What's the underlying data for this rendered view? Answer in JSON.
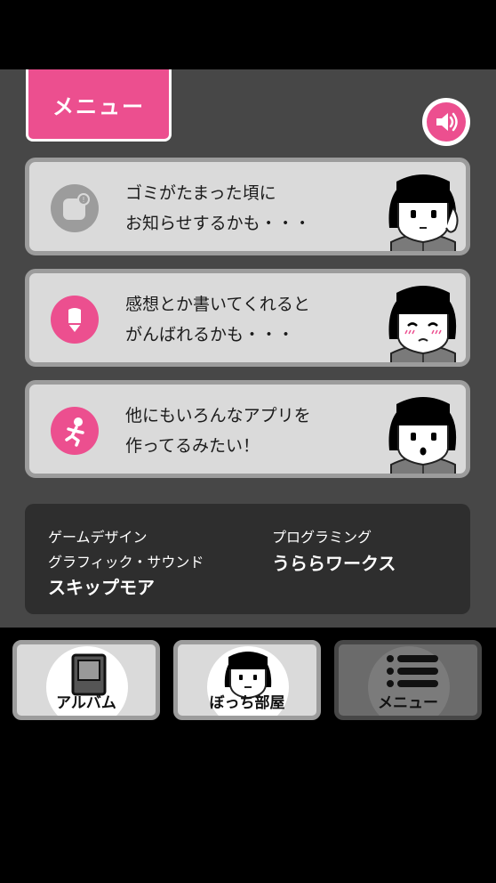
{
  "header": {
    "menu_tab_label": "メニュー",
    "sound_icon": "speaker-icon"
  },
  "cards": [
    {
      "icon": "notification-icon",
      "line1": "ゴミがたまった頃に",
      "line2": "お知らせするかも・・・",
      "face": "neutral"
    },
    {
      "icon": "pencil-icon",
      "line1": "感想とか書いてくれると",
      "line2": "がんばれるかも・・・",
      "face": "blushing"
    },
    {
      "icon": "running-person-icon",
      "line1": "他にもいろんなアプリを",
      "line2": "作ってるみたい！",
      "face": "surprised"
    }
  ],
  "credits": {
    "design_label": "ゲームデザイン",
    "graphics_label": "グラフィック・サウンド",
    "design_name": "スキップモア",
    "programming_label": "プログラミング",
    "programming_name": "うららワークス"
  },
  "nav": {
    "album_label": "アルバム",
    "room_label": "ぼっち部屋",
    "menu_label": "メニュー"
  },
  "colors": {
    "accent": "#ec4f8f",
    "panel": "#474747",
    "card": "#dadada",
    "card_border": "#9c9c9c",
    "credits_bg": "#2e2e2e"
  }
}
